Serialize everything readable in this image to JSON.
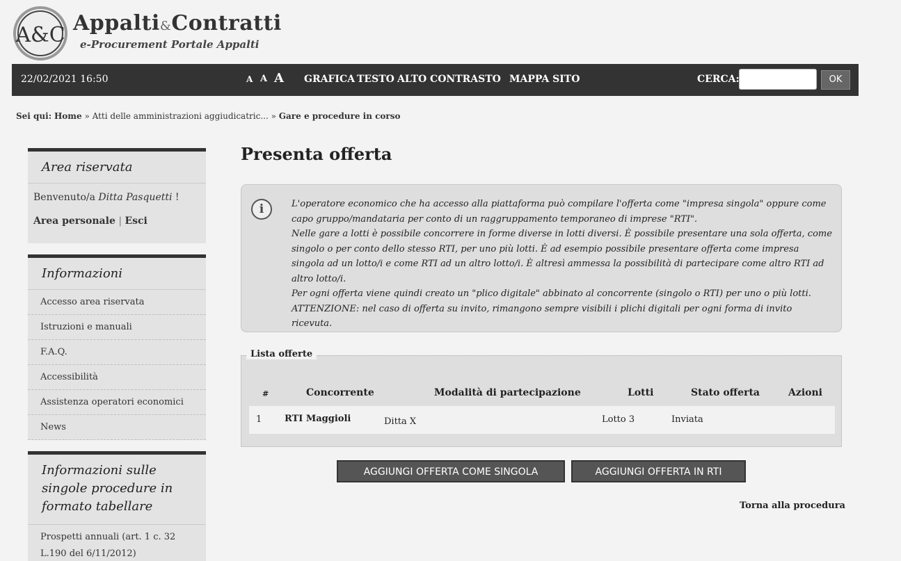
{
  "brand": {
    "title_a": "Appalti",
    "amp": "&",
    "title_b": "Contratti",
    "subtitle": "e-Procurement Portale Appalti",
    "logo_text": "A&C"
  },
  "topbar": {
    "datetime": "22/02/2021 16:50",
    "font_sizes": [
      "A",
      "A",
      "A"
    ],
    "links": [
      "GRAFICA",
      "TESTO",
      "ALTO CONTRASTO",
      "MAPPA SITO"
    ],
    "search_label": "CERCA:",
    "search_value": "",
    "ok_label": "OK"
  },
  "breadcrumb": {
    "prefix": "Sei qui:",
    "home": "Home",
    "sep": "»",
    "middle": "Atti delle amministrazioni aggiudicatric...",
    "current": "Gare e procedure in corso"
  },
  "sidebar": {
    "area_riservata": {
      "title": "Area riservata",
      "welcome_prefix": "Benvenuto/a",
      "user": "Ditta Pasquetti",
      "welcome_suffix": "!",
      "personal": "Area personale",
      "divider": "|",
      "logout": "Esci"
    },
    "informazioni": {
      "title": "Informazioni",
      "items": [
        "Accesso area riservata",
        "Istruzioni e manuali",
        "F.A.Q.",
        "Accessibilità",
        "Assistenza operatori economici",
        "News"
      ]
    },
    "tabellare": {
      "title": "Informazioni sulle singole procedure in formato tabellare",
      "item": "Prospetti annuali (art. 1 c. 32 L.190 del 6/11/2012)"
    }
  },
  "main": {
    "title": "Presenta offerta",
    "info_icon": "i",
    "info_lines": [
      "L'operatore economico che ha accesso alla piattaforma può compilare l'offerta come \"impresa singola\" oppure come capo gruppo/mandataria per conto di un raggruppamento temporaneo di imprese \"RTI\".",
      "Nelle gare a lotti è possibile concorrere in forme diverse in lotti diversi. È possibile presentare una sola offerta, come singolo o per conto dello stesso RTI, per uno più lotti. È ad esempio possibile presentare offerta come impresa singola ad un lotto/i e come RTI ad un altro lotto/i. È altresì ammessa la possibilità di partecipare come altro RTI ad altro lotto/i.",
      "Per ogni offerta viene quindi creato un \"plico digitale\" abbinato al concorrente (singolo o RTI) per uno o più lotti.",
      "ATTENZIONE: nel caso di offerta su invito, rimangono sempre visibili i plichi digitali per ogni forma di invito ricevuta."
    ],
    "list_title": "Lista offerte",
    "columns": [
      "#",
      "Concorrente",
      "Modalità di partecipazione",
      "Lotti",
      "Stato offerta",
      "Azioni"
    ],
    "rows": [
      {
        "num": "1",
        "concorrente": "RTI Maggioli",
        "modalita": "Ditta X",
        "lotti": "Lotto 3",
        "stato": "Inviata",
        "azioni": ""
      }
    ],
    "btn_singola": "AGGIUNGI OFFERTA COME SINGOLA",
    "btn_rti": "AGGIUNGI OFFERTA IN RTI",
    "back_link": "Torna alla procedura"
  }
}
